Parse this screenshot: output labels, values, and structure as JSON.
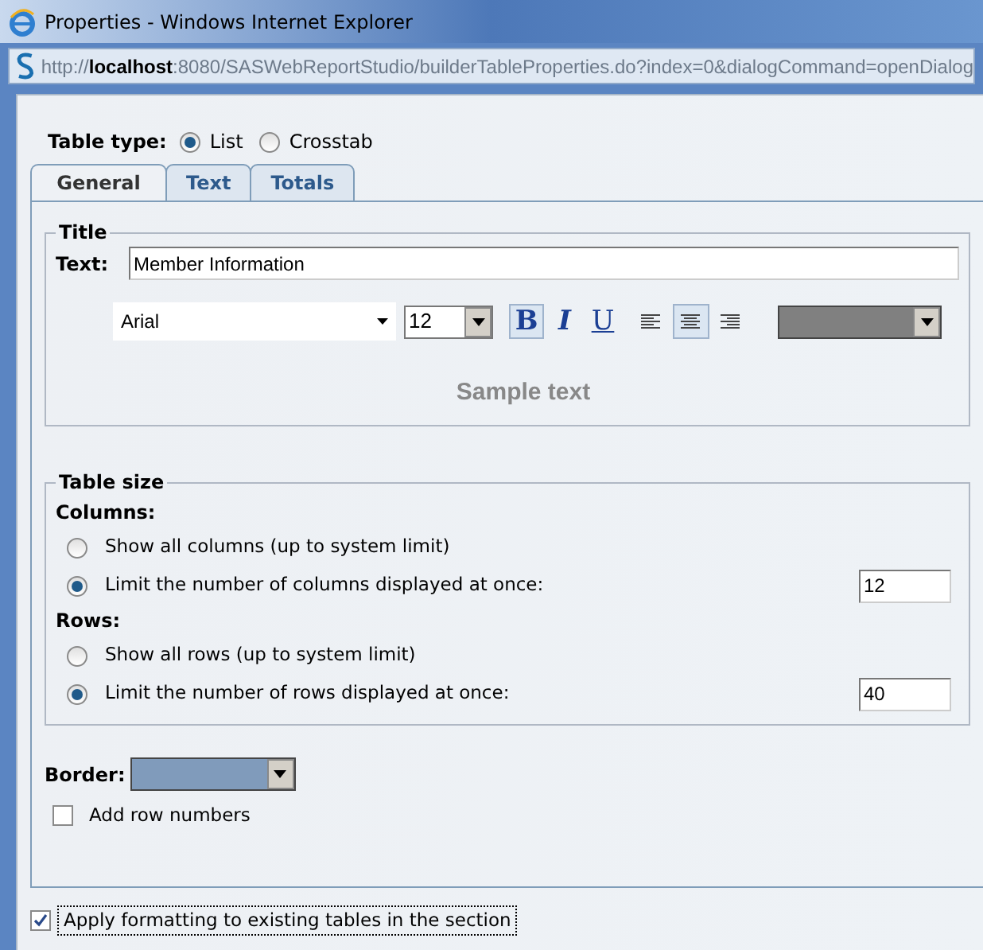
{
  "window": {
    "title": "Properties - Windows Internet Explorer"
  },
  "address_bar": {
    "url": "http://**localhost**:8080/SASWebReportStudio/builderTableProperties.do?index=0&dialogCommand=openDialog"
  },
  "table_type": {
    "label": "Table type:",
    "options": [
      {
        "label": "List",
        "selected": true
      },
      {
        "label": "Crosstab",
        "selected": false
      }
    ]
  },
  "tabs": [
    {
      "label": "General",
      "selected": true
    },
    {
      "label": "Text",
      "selected": false
    },
    {
      "label": "Totals",
      "selected": false
    }
  ],
  "title_group": {
    "legend": "Title",
    "text_label": "Text:",
    "text_value": "Member Information",
    "font": "Arial",
    "size": "12",
    "style_buttons": [
      {
        "kind": "bold",
        "label": "B",
        "selected": true
      },
      {
        "kind": "italic",
        "label": "I",
        "selected": false
      },
      {
        "kind": "underline",
        "label": "U",
        "selected": false
      }
    ],
    "align_buttons": [
      {
        "kind": "left",
        "selected": false
      },
      {
        "kind": "center",
        "selected": true
      },
      {
        "kind": "right",
        "selected": false
      }
    ],
    "text_color": {
      "color": "#808080"
    },
    "sample": "Sample text"
  },
  "table_size": {
    "legend": "Table size",
    "sections": [
      {
        "heading": "Columns:",
        "options": [
          {
            "label": "Show all columns (up to system limit)",
            "selected": false
          },
          {
            "label": "Limit the number of columns displayed at once:",
            "selected": true,
            "value": "12"
          }
        ]
      },
      {
        "heading": "Rows:",
        "options": [
          {
            "label": "Show all rows (up to system limit)",
            "selected": false
          },
          {
            "label": "Limit the number of rows displayed at once:",
            "selected": true,
            "value": "40"
          }
        ]
      }
    ]
  },
  "border": {
    "label": "Border:",
    "color": "#809bbb"
  },
  "add_row_numbers": {
    "label": "Add row numbers",
    "checked": false
  },
  "apply_formatting": {
    "label": "Apply formatting to existing tables in the section",
    "checked": true
  }
}
